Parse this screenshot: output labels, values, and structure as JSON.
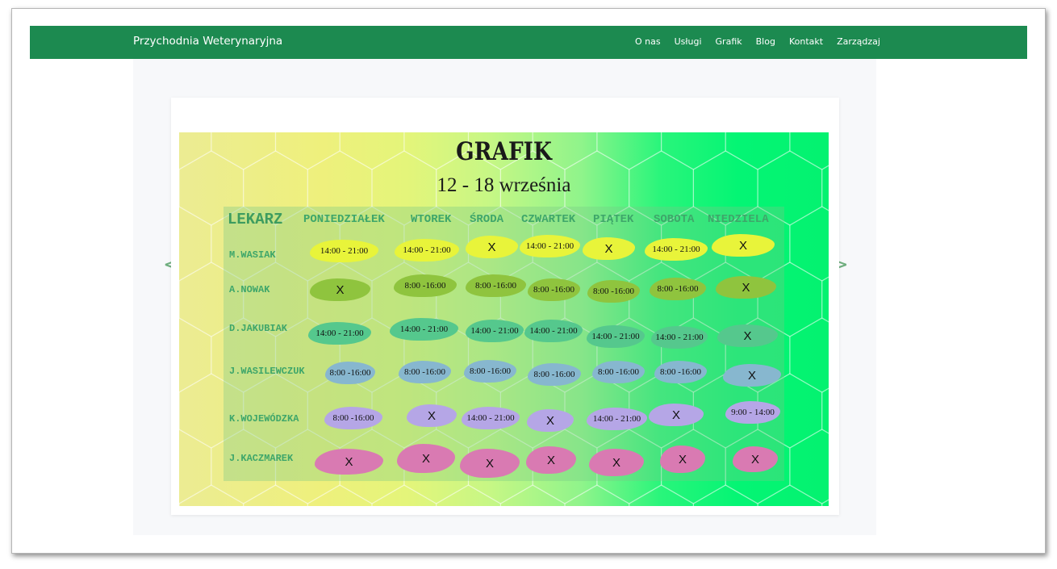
{
  "navbar": {
    "brand": "Przychodnia Weterynaryjna",
    "links": [
      "O nas",
      "Usługi",
      "Grafik",
      "Blog",
      "Kontakt",
      "Zarządzaj"
    ]
  },
  "carousel": {
    "prev_glyph": "<",
    "next_glyph": ">"
  },
  "schedule": {
    "title": "GRAFIK",
    "subtitle": "12 - 18 września",
    "header": [
      "LEKARZ",
      "PONIEDZIAŁEK",
      "WTOREK",
      "ŚRODA",
      "CZWARTEK",
      "PIĄTEK",
      "SOBOTA",
      "NIEDZIELA"
    ],
    "rows": [
      {
        "doctor": "M.WASIAK",
        "cells": [
          "14:00 - 21:00",
          "14:00 - 21:00",
          "X",
          "14:00 - 21:00",
          "X",
          "14:00 - 21:00",
          "X"
        ]
      },
      {
        "doctor": "A.NOWAK",
        "cells": [
          "X",
          "8:00 -16:00",
          "8:00 -16:00",
          "8:00 -16:00",
          "8:00 -16:00",
          "8:00 -16:00",
          "X"
        ]
      },
      {
        "doctor": "D.JAKUBIAK",
        "cells": [
          "14:00 - 21:00",
          "14:00 - 21:00",
          "14:00 - 21:00",
          "14:00 - 21:00",
          "14:00 - 21:00",
          "14:00 - 21:00",
          "X"
        ]
      },
      {
        "doctor": "J.WASILEWCZUK",
        "cells": [
          "8:00 -16:00",
          "8:00 -16:00",
          "8:00 -16:00",
          "8:00 -16:00",
          "8:00 -16:00",
          "8:00 -16:00",
          "X"
        ]
      },
      {
        "doctor": "K.WOJEWÓDZKA",
        "cells": [
          "8:00 -16:00",
          "X",
          "14:00 - 21:00",
          "X",
          "14:00 - 21:00",
          "X",
          "9:00 - 14:00"
        ]
      },
      {
        "doctor": "J.KACZMAREK",
        "cells": [
          "X",
          "X",
          "X",
          "X",
          "X",
          "X",
          "X"
        ]
      }
    ]
  },
  "colors": {
    "navbar": "#1c8a50",
    "header_text": "#3ea66a",
    "row_colors": [
      "#e8f43a",
      "#8fc43e",
      "#55c88d",
      "#87b7cf",
      "#b5a6e6",
      "#d97ab2"
    ]
  }
}
